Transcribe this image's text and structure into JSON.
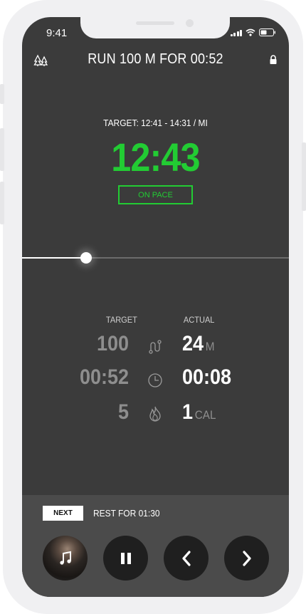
{
  "status_bar": {
    "time": "9:41"
  },
  "header": {
    "title": "RUN 100 M FOR 00:52"
  },
  "pace": {
    "target_range": "TARGET: 12:41 - 14:31 / MI",
    "current": "12:43",
    "status": "ON PACE",
    "accent_color": "#22cc33"
  },
  "progress": {
    "fraction": 0.24
  },
  "stats": {
    "target_header": "TARGET",
    "actual_header": "ACTUAL",
    "rows": [
      {
        "icon": "route-icon",
        "target": "100",
        "actual": "24",
        "unit": "M"
      },
      {
        "icon": "clock-icon",
        "target": "00:52",
        "actual": "00:08",
        "unit": ""
      },
      {
        "icon": "flame-icon",
        "target": "5",
        "actual": "1",
        "unit": "CAL"
      }
    ]
  },
  "next_up": {
    "badge": "NEXT",
    "text": "REST FOR 01:30"
  },
  "controls": [
    "music-button",
    "pause-button",
    "previous-button",
    "next-button"
  ]
}
